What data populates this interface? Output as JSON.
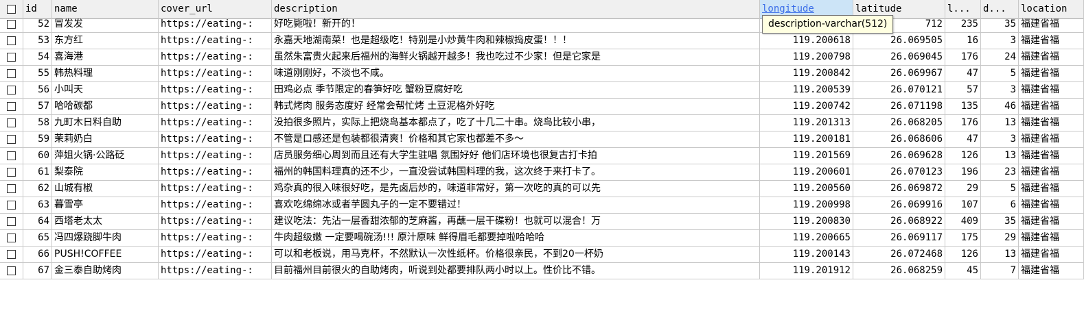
{
  "columns": [
    {
      "key": "select",
      "label": ""
    },
    {
      "key": "id",
      "label": "id"
    },
    {
      "key": "name",
      "label": "name"
    },
    {
      "key": "cover_url",
      "label": "cover_url"
    },
    {
      "key": "description",
      "label": "description"
    },
    {
      "key": "longitude",
      "label": "longitude",
      "selected": true
    },
    {
      "key": "latitude",
      "label": "latitude"
    },
    {
      "key": "l",
      "label": "l..."
    },
    {
      "key": "d",
      "label": "d..."
    },
    {
      "key": "location",
      "label": "location"
    }
  ],
  "tooltip": "description-varchar(512)",
  "rows": [
    {
      "id": "52",
      "name": "冒发发",
      "cover_url": "https://eating-:",
      "description": "好吃毙啦！新开的！",
      "longitude": "",
      "latitude": "712",
      "l": "235",
      "d": "35",
      "location": "福建省福"
    },
    {
      "id": "53",
      "name": "东方红",
      "cover_url": "https://eating-:",
      "description": "永嘉天地湖南菜！也是超级吃！特别是小炒黄牛肉和辣椒捣皮蛋！！！",
      "longitude": "119.200618",
      "latitude": "26.069505",
      "l": "16",
      "d": "3",
      "location": "福建省福"
    },
    {
      "id": "54",
      "name": "喜海港",
      "cover_url": "https://eating-:",
      "description": "虽然朱富贵火起来后福州的海鲜火锅越开越多！我也吃过不少家！但是它家是",
      "longitude": "119.200798",
      "latitude": "26.069045",
      "l": "176",
      "d": "24",
      "location": "福建省福"
    },
    {
      "id": "55",
      "name": "韩热料理",
      "cover_url": "https://eating-:",
      "description": "味道刚刚好，不淡也不咸。",
      "longitude": "119.200842",
      "latitude": "26.069967",
      "l": "47",
      "d": "5",
      "location": "福建省福"
    },
    {
      "id": "56",
      "name": "小叫天",
      "cover_url": "https://eating-:",
      "description": "田鸡必点 季节限定的春笋好吃 蟹粉豆腐好吃",
      "longitude": "119.200539",
      "latitude": "26.070121",
      "l": "57",
      "d": "3",
      "location": "福建省福"
    },
    {
      "id": "57",
      "name": "哈哈碳都",
      "cover_url": "https://eating-:",
      "description": "韩式烤肉 服务态度好 经常会帮忙烤 土豆泥格外好吃",
      "longitude": "119.200742",
      "latitude": "26.071198",
      "l": "135",
      "d": "46",
      "location": "福建省福"
    },
    {
      "id": "58",
      "name": "九町木日料自助",
      "cover_url": "https://eating-:",
      "description": "没拍很多照片，实际上把烧鸟基本都点了，吃了十几二十串。烧鸟比较小串，",
      "longitude": "119.201313",
      "latitude": "26.068205",
      "l": "176",
      "d": "13",
      "location": "福建省福"
    },
    {
      "id": "59",
      "name": "茉莉奶白",
      "cover_url": "https://eating-:",
      "description": "不管是口感还是包装都很清爽！价格和其它家也都差不多～",
      "longitude": "119.200181",
      "latitude": "26.068606",
      "l": "47",
      "d": "3",
      "location": "福建省福"
    },
    {
      "id": "60",
      "name": "萍姐火锅·公路砭",
      "cover_url": "https://eating-:",
      "description": "店员服务细心周到而且还有大学生驻唱 氛围好好 他们店环境也很复古打卡拍",
      "longitude": "119.201569",
      "latitude": "26.069628",
      "l": "126",
      "d": "13",
      "location": "福建省福"
    },
    {
      "id": "61",
      "name": "梨泰院",
      "cover_url": "https://eating-:",
      "description": "福州的韩国料理真的还不少，一直没尝试韩国料理的我，这次终于来打卡了。",
      "longitude": "119.200601",
      "latitude": "26.070123",
      "l": "196",
      "d": "23",
      "location": "福建省福"
    },
    {
      "id": "62",
      "name": "山城有椒",
      "cover_url": "https://eating-:",
      "description": "鸡杂真的很入味很好吃，是先卤后炒的，味道非常好，第一次吃的真的可以先",
      "longitude": "119.200560",
      "latitude": "26.069872",
      "l": "29",
      "d": "5",
      "location": "福建省福"
    },
    {
      "id": "63",
      "name": "暮雪亭",
      "cover_url": "https://eating-:",
      "description": "喜欢吃绵绵冰或者芋圆丸子的一定不要错过！",
      "longitude": "119.200998",
      "latitude": "26.069916",
      "l": "107",
      "d": "6",
      "location": "福建省福"
    },
    {
      "id": "64",
      "name": "西塔老太太",
      "cover_url": "https://eating-:",
      "description": "建议吃法：先沾一层香甜浓郁的芝麻酱，再蘸一层干碟粉！也就可以混合！万",
      "longitude": "119.200830",
      "latitude": "26.068922",
      "l": "409",
      "d": "35",
      "location": "福建省福"
    },
    {
      "id": "65",
      "name": "冯四爆跷脚牛肉",
      "cover_url": "https://eating-:",
      "description": "牛肉超级嫩 一定要喝碗汤!!! 原汁原味 鲜得眉毛都要掉啦哈哈哈",
      "longitude": "119.200665",
      "latitude": "26.069117",
      "l": "175",
      "d": "29",
      "location": "福建省福"
    },
    {
      "id": "66",
      "name": "PUSH!COFFEE",
      "cover_url": "https://eating-:",
      "description": "可以和老板说，用马克杯，不然默认一次性纸杯。价格很亲民，不到20一杯奶",
      "longitude": "119.200143",
      "latitude": "26.072468",
      "l": "126",
      "d": "13",
      "location": "福建省福"
    },
    {
      "id": "67",
      "name": "金三泰自助烤肉",
      "cover_url": "https://eating-:",
      "description": "目前福州目前很火的自助烤肉，听说到处都要排队两小时以上。性价比不错。",
      "longitude": "119.201912",
      "latitude": "26.068259",
      "l": "45",
      "d": "7",
      "location": "福建省福"
    }
  ]
}
